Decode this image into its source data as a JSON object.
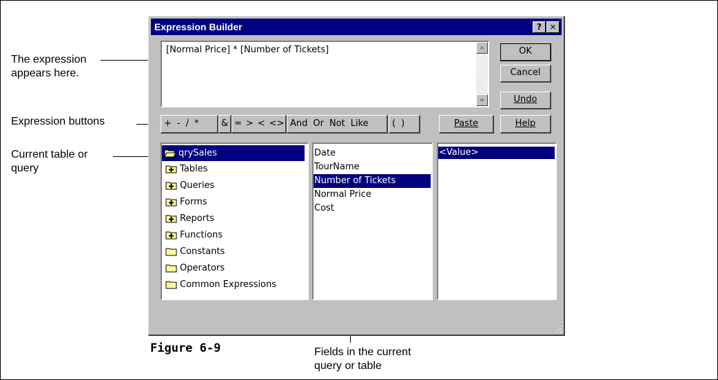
{
  "callouts": {
    "expression": [
      "The expression",
      "appears here."
    ],
    "buttons": "Expression buttons",
    "table": [
      "Current table or",
      "query"
    ],
    "fields": [
      "Fields in the current",
      "query or table"
    ]
  },
  "figure_caption": "Figure 6-9",
  "dialog": {
    "title": "Expression Builder",
    "help_glyph": "?",
    "close_glyph": "✕",
    "expression_text": "[Normal Price] * [Number of Tickets]",
    "buttons": {
      "ok": "OK",
      "cancel": "Cancel",
      "undo": "Undo",
      "paste": "Paste",
      "help": "Help"
    },
    "operators": {
      "arith": [
        "+",
        "-",
        "/",
        "*"
      ],
      "concat": "&",
      "compare": [
        "=",
        ">",
        "<",
        "<>"
      ],
      "logic": [
        "And",
        "Or",
        "Not",
        "Like"
      ],
      "parens": [
        "(",
        ")"
      ]
    },
    "tree": [
      {
        "label": "qrySales",
        "icon": "open-folder-icon",
        "selected": true
      },
      {
        "label": "Tables",
        "icon": "plus-folder-icon"
      },
      {
        "label": "Queries",
        "icon": "plus-folder-icon"
      },
      {
        "label": "Forms",
        "icon": "plus-folder-icon"
      },
      {
        "label": "Reports",
        "icon": "plus-folder-icon"
      },
      {
        "label": "Functions",
        "icon": "plus-folder-icon"
      },
      {
        "label": "Constants",
        "icon": "folder-icon"
      },
      {
        "label": "Operators",
        "icon": "folder-icon"
      },
      {
        "label": "Common Expressions",
        "icon": "folder-icon"
      }
    ],
    "fields": [
      {
        "label": "Date"
      },
      {
        "label": "TourName"
      },
      {
        "label": "Number of Tickets",
        "selected": true
      },
      {
        "label": "Normal Price"
      },
      {
        "label": "Cost"
      }
    ],
    "values": [
      {
        "label": "<Value>",
        "selected": true
      }
    ],
    "colors": {
      "title_bar": "#000080",
      "selection": "#000080",
      "face": "#c0c0c0",
      "folder": "#ffff99"
    }
  }
}
